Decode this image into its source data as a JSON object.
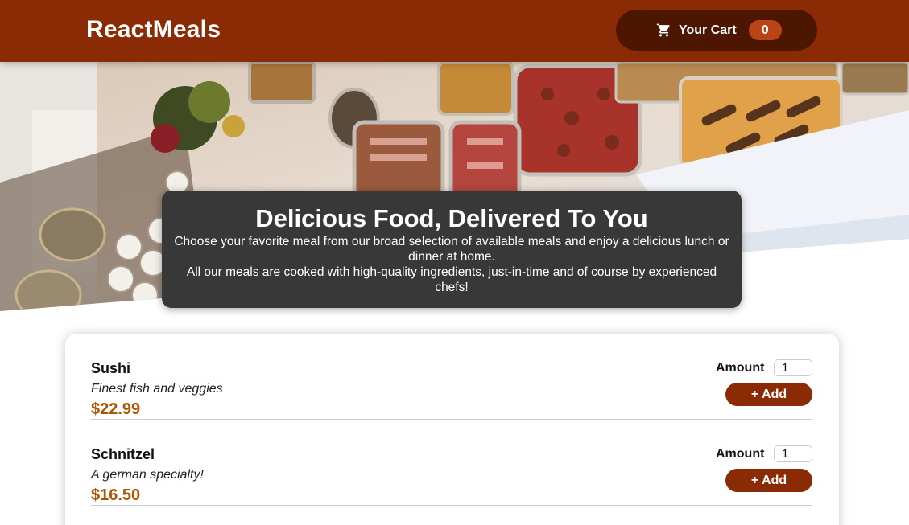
{
  "header": {
    "brand": "ReactMeals",
    "cart": {
      "label": "Your Cart",
      "count": "0",
      "icon": "cart-icon"
    }
  },
  "summary": {
    "title": "Delicious Food, Delivered To You",
    "line1": "Choose your favorite meal from our broad selection of available meals and enjoy a delicious lunch or dinner at home.",
    "line2": "All our meals are cooked with high-quality ingredients, just-in-time and of course by experienced chefs!"
  },
  "meals": [
    {
      "name": "Sushi",
      "description": "Finest fish and veggies",
      "price": "$22.99",
      "amount_label": "Amount",
      "amount_value": "1",
      "add_label": "+ Add"
    },
    {
      "name": "Schnitzel",
      "description": "A german specialty!",
      "price": "$16.50",
      "amount_label": "Amount",
      "amount_value": "1",
      "add_label": "+ Add"
    }
  ],
  "colors": {
    "header": "#8a2b06",
    "cart_button": "#4d1601",
    "cart_badge": "#b94517",
    "summary_bg": "#383838",
    "price": "#ad5502"
  }
}
